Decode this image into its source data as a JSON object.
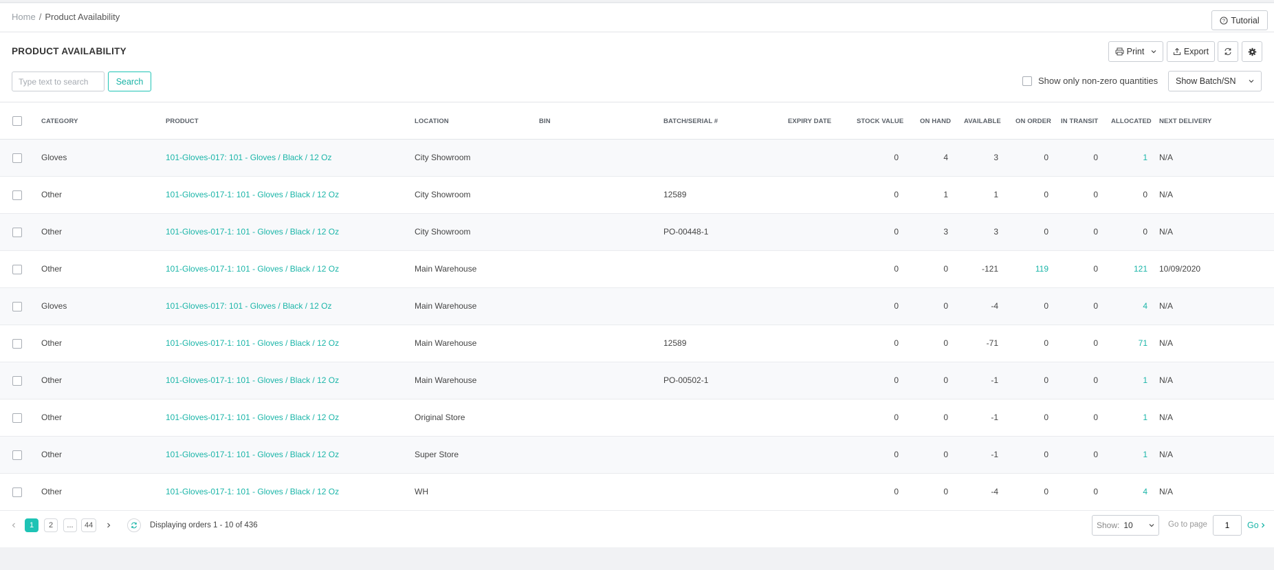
{
  "breadcrumb": {
    "home": "Home",
    "separator": "/",
    "current": "Product Availability"
  },
  "header": {
    "tutorial_label": "Tutorial"
  },
  "toolbar": {
    "title": "PRODUCT AVAILABILITY",
    "print_label": "Print",
    "export_label": "Export",
    "search_placeholder": "Type text to search",
    "search_label": "Search",
    "nonzero_label": "Show only non-zero quantities",
    "batch_select_value": "Show Batch/SN"
  },
  "colors": {
    "accent": "#1ec3b5",
    "link": "#1ab5a8"
  },
  "table": {
    "columns": [
      "CATEGORY",
      "PRODUCT",
      "LOCATION",
      "BIN",
      "BATCH/SERIAL #",
      "EXPIRY DATE",
      "STOCK VALUE",
      "ON HAND",
      "AVAILABLE",
      "ON ORDER",
      "IN TRANSIT",
      "ALLOCATED",
      "NEXT DELIVERY"
    ],
    "rows": [
      {
        "category": "Gloves",
        "product": "101-Gloves-017: 101 - Gloves / Black / 12 Oz",
        "location": "City Showroom",
        "bin": "",
        "batch": "",
        "expiry": "",
        "stock_value": "0",
        "on_hand": "4",
        "available": "3",
        "on_order": "0",
        "in_transit": "0",
        "allocated": "1",
        "next_delivery": "N/A"
      },
      {
        "category": "Other",
        "product": "101-Gloves-017-1: 101 - Gloves / Black / 12 Oz",
        "location": "City Showroom",
        "bin": "",
        "batch": "12589",
        "expiry": "",
        "stock_value": "0",
        "on_hand": "1",
        "available": "1",
        "on_order": "0",
        "in_transit": "0",
        "allocated": "0",
        "next_delivery": "N/A"
      },
      {
        "category": "Other",
        "product": "101-Gloves-017-1: 101 - Gloves / Black / 12 Oz",
        "location": "City Showroom",
        "bin": "",
        "batch": "PO-00448-1",
        "expiry": "",
        "stock_value": "0",
        "on_hand": "3",
        "available": "3",
        "on_order": "0",
        "in_transit": "0",
        "allocated": "0",
        "next_delivery": "N/A"
      },
      {
        "category": "Other",
        "product": "101-Gloves-017-1: 101 - Gloves / Black / 12 Oz",
        "location": "Main Warehouse",
        "bin": "",
        "batch": "",
        "expiry": "",
        "stock_value": "0",
        "on_hand": "0",
        "available": "-121",
        "on_order": "119",
        "in_transit": "0",
        "allocated": "121",
        "next_delivery": "10/09/2020"
      },
      {
        "category": "Gloves",
        "product": "101-Gloves-017: 101 - Gloves / Black / 12 Oz",
        "location": "Main Warehouse",
        "bin": "",
        "batch": "",
        "expiry": "",
        "stock_value": "0",
        "on_hand": "0",
        "available": "-4",
        "on_order": "0",
        "in_transit": "0",
        "allocated": "4",
        "next_delivery": "N/A"
      },
      {
        "category": "Other",
        "product": "101-Gloves-017-1: 101 - Gloves / Black / 12 Oz",
        "location": "Main Warehouse",
        "bin": "",
        "batch": "12589",
        "expiry": "",
        "stock_value": "0",
        "on_hand": "0",
        "available": "-71",
        "on_order": "0",
        "in_transit": "0",
        "allocated": "71",
        "next_delivery": "N/A"
      },
      {
        "category": "Other",
        "product": "101-Gloves-017-1: 101 - Gloves / Black / 12 Oz",
        "location": "Main Warehouse",
        "bin": "",
        "batch": "PO-00502-1",
        "expiry": "",
        "stock_value": "0",
        "on_hand": "0",
        "available": "-1",
        "on_order": "0",
        "in_transit": "0",
        "allocated": "1",
        "next_delivery": "N/A"
      },
      {
        "category": "Other",
        "product": "101-Gloves-017-1: 101 - Gloves / Black / 12 Oz",
        "location": "Original Store",
        "bin": "",
        "batch": "",
        "expiry": "",
        "stock_value": "0",
        "on_hand": "0",
        "available": "-1",
        "on_order": "0",
        "in_transit": "0",
        "allocated": "1",
        "next_delivery": "N/A"
      },
      {
        "category": "Other",
        "product": "101-Gloves-017-1: 101 - Gloves / Black / 12 Oz",
        "location": "Super Store",
        "bin": "",
        "batch": "",
        "expiry": "",
        "stock_value": "0",
        "on_hand": "0",
        "available": "-1",
        "on_order": "0",
        "in_transit": "0",
        "allocated": "1",
        "next_delivery": "N/A"
      },
      {
        "category": "Other",
        "product": "101-Gloves-017-1: 101 - Gloves / Black / 12 Oz",
        "location": "WH",
        "bin": "",
        "batch": "",
        "expiry": "",
        "stock_value": "0",
        "on_hand": "0",
        "available": "-4",
        "on_order": "0",
        "in_transit": "0",
        "allocated": "4",
        "next_delivery": "N/A"
      }
    ]
  },
  "pagination": {
    "pages": [
      "1",
      "2",
      "...",
      "44"
    ],
    "display_text": "Displaying orders 1 - 10 of 436",
    "show_label": "Show:",
    "show_value": "10",
    "goto_label": "Go to page",
    "goto_value": "1",
    "go_label": "Go"
  }
}
